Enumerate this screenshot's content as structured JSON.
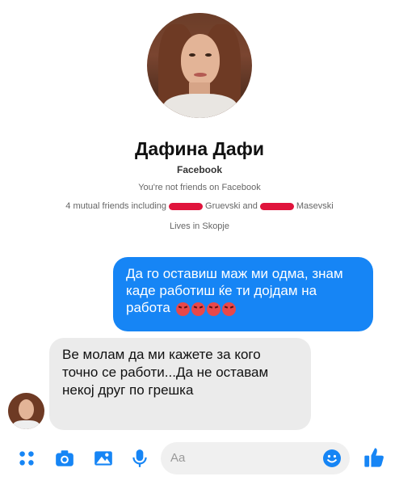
{
  "profile": {
    "name": "Дафина Дафи",
    "platform": "Facebook",
    "not_friends": "You're not friends on Facebook",
    "mutual_prefix": "4 mutual friends including",
    "mutual_mid": "Gruevski and",
    "mutual_end": "Masevski",
    "lives": "Lives in Skopje"
  },
  "messages": {
    "outgoing": "Да го оставиш маж ми одма, знам каде работиш ќе ти дојдам на работа",
    "incoming": "Ве молам да ми кажете за кого точно се работи...Да не оставам некој друг по грешка"
  },
  "composer": {
    "placeholder": "Aa",
    "icons": [
      "grid-icon",
      "camera-icon",
      "image-icon",
      "microphone-icon",
      "emoji-icon",
      "thumbs-up-icon"
    ],
    "accent": "#1685f5"
  },
  "colors": {
    "outgoing_bubble": "#1685f5",
    "incoming_bubble": "#ebebeb",
    "redaction": "#e0143c"
  }
}
